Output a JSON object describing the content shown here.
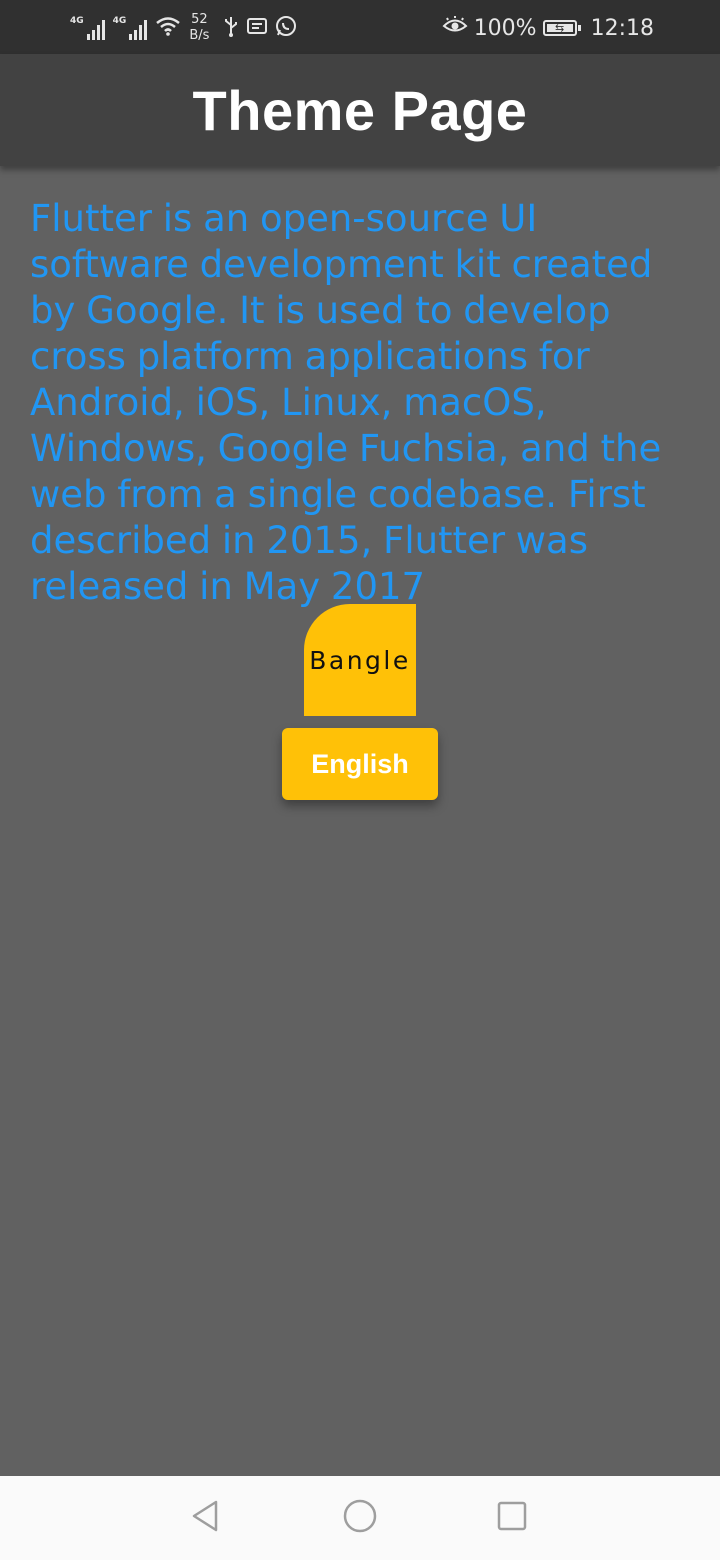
{
  "status_bar": {
    "network_type_1": "4G",
    "network_type_2": "4G",
    "speed_value": "52",
    "speed_unit": "B/s",
    "battery_percent": "100%",
    "battery_level": 1.0,
    "time": "12:18",
    "icons": [
      "signal-icon",
      "signal-icon",
      "wifi-icon",
      "usb-icon",
      "message-icon",
      "whatsapp-icon",
      "eye-comfort-icon",
      "battery-icon"
    ]
  },
  "app_bar": {
    "title": "Theme Page"
  },
  "body": {
    "text": "Flutter is an open-source UI software development kit created by Google. It is used to develop cross platform applications for Android, iOS, Linux, macOS, Windows, Google Fuchsia, and the web from a single codebase. First described in 2015, Flutter was released in May 2017"
  },
  "buttons": {
    "bangle_label": "Bangle",
    "english_label": "English"
  },
  "nav_bar": {
    "icons": [
      "back-icon",
      "home-icon",
      "recent-apps-icon"
    ]
  },
  "colors": {
    "background": "#616161",
    "app_bar": "#424242",
    "status_bar": "#303030",
    "text_accent": "#2196f3",
    "button": "#ffc107",
    "nav_bar": "#fafafa"
  }
}
